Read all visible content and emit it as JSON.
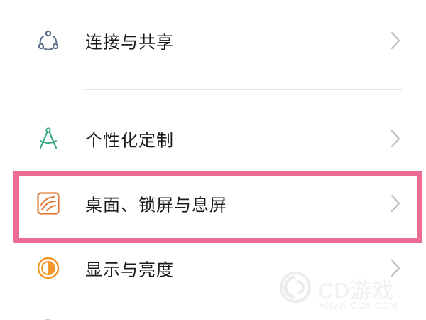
{
  "settings": {
    "items": [
      {
        "label": "连接与共享",
        "icon": "share-nodes-icon",
        "icon_color": "#5a6a8a"
      },
      {
        "label": "个性化定制",
        "icon": "compass-icon",
        "icon_color": "#3aa985"
      },
      {
        "label": "桌面、锁屏与息屏",
        "icon": "wallpaper-icon",
        "icon_color": "#e07a3a",
        "highlighted": true
      },
      {
        "label": "显示与亮度",
        "icon": "brightness-icon",
        "icon_color": "#f0962a"
      }
    ]
  },
  "highlight": {
    "color": "#ec6c93"
  },
  "watermark": {
    "brand": "CD游戏",
    "url": "WWW.CD5.COM"
  }
}
